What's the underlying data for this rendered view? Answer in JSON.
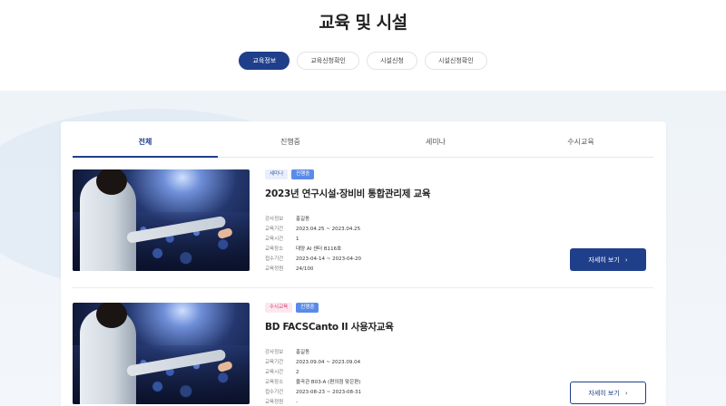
{
  "header": {
    "title": "교육 및 시설",
    "pills": [
      {
        "label": "교육정보",
        "active": true
      },
      {
        "label": "교육신청확인",
        "active": false
      },
      {
        "label": "시설신청",
        "active": false
      },
      {
        "label": "시설신청확인",
        "active": false
      }
    ]
  },
  "tabs": [
    {
      "label": "전체",
      "active": true
    },
    {
      "label": "진행중",
      "active": false
    },
    {
      "label": "세미나",
      "active": false
    },
    {
      "label": "수시교육",
      "active": false
    }
  ],
  "items": [
    {
      "badges": [
        {
          "label": "세미나",
          "type": "seminar"
        },
        {
          "label": "진행중",
          "type": "ongoing"
        }
      ],
      "title": "2023년 연구시설·장비비 통합관리제 교육",
      "meta": [
        {
          "k": "강사정보",
          "v": "홍길동"
        },
        {
          "k": "교육기간",
          "v": "2023.04.25 ~ 2023.04.25"
        },
        {
          "k": "교육시간",
          "v": "1"
        },
        {
          "k": "교육장소",
          "v": "대양 AI 센터 B116호"
        },
        {
          "k": "접수기간",
          "v": "2023-04-14 ~ 2023-04-20"
        },
        {
          "k": "교육정원",
          "v": "24/100"
        }
      ],
      "button": "자세히 보기",
      "button_style": "solid"
    },
    {
      "badges": [
        {
          "label": "수시교육",
          "type": "always"
        },
        {
          "label": "진행중",
          "type": "ongoing"
        }
      ],
      "title": "BD FACSCanto II 사용자교육",
      "meta": [
        {
          "k": "강사정보",
          "v": "홍길동"
        },
        {
          "k": "교육기간",
          "v": "2023.09.04 ~ 2023.09.04"
        },
        {
          "k": "교육시간",
          "v": "2"
        },
        {
          "k": "교육장소",
          "v": "율곡관 B03-A (편의점 맞은편)"
        },
        {
          "k": "접수기간",
          "v": "2023-08-23 ~ 2023-08-31"
        },
        {
          "k": "교육정원",
          "v": "-"
        }
      ],
      "button": "자세히 보기",
      "button_style": "outline"
    }
  ],
  "icons": {
    "chevron": "chevron-right-icon"
  },
  "colors": {
    "primary": "#1f3f8a",
    "ongoing": "#5b8be8",
    "seminar_text": "#3a57a8",
    "always_text": "#d23a6b"
  }
}
